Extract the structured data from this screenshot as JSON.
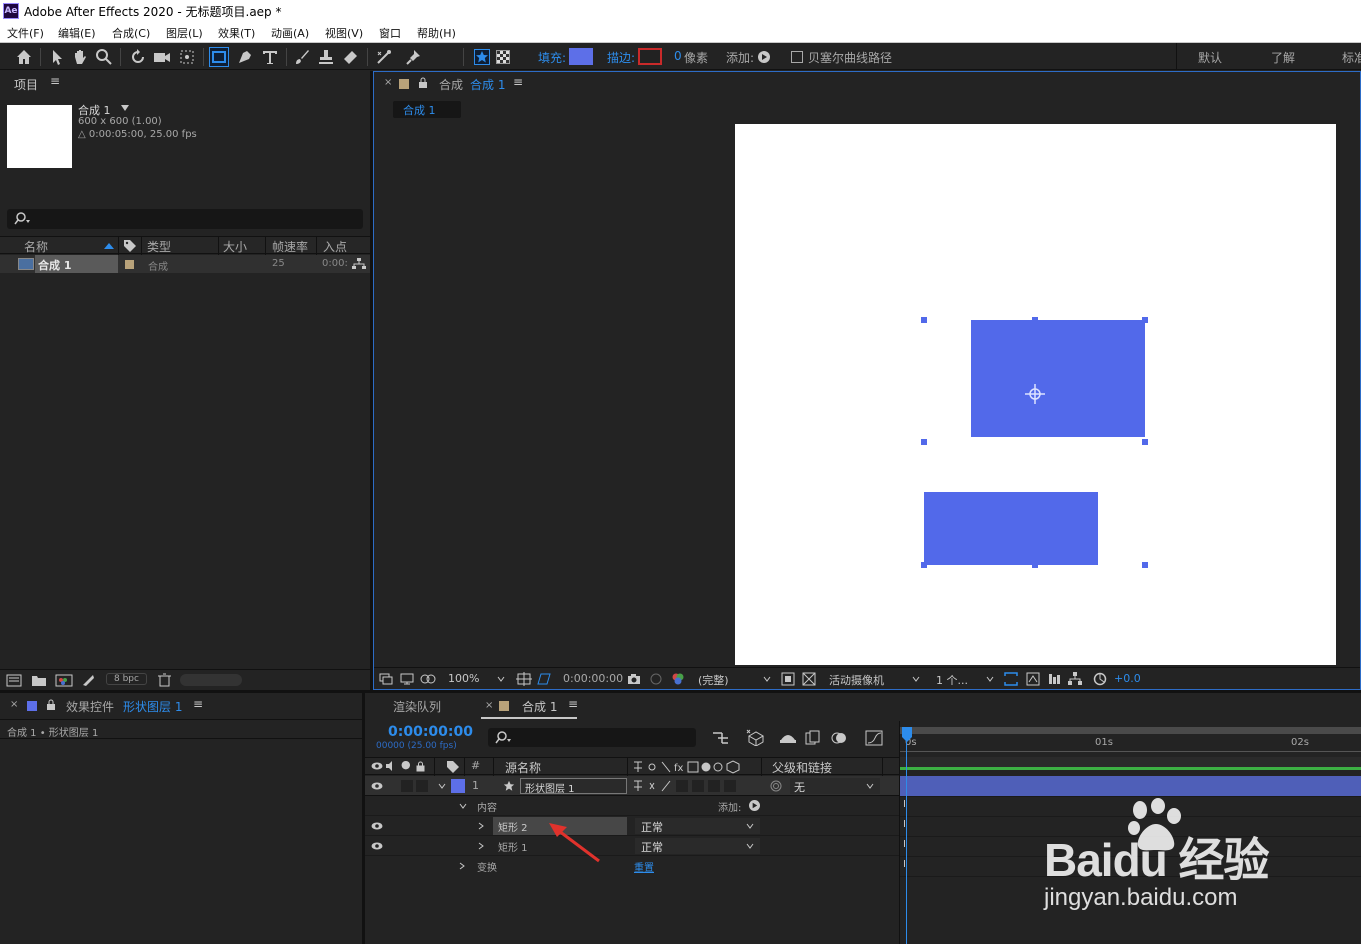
{
  "app": {
    "title": "Adobe After Effects 2020 - 无标题项目.aep *",
    "logo": "Ae"
  },
  "menu": [
    "文件(F)",
    "编辑(E)",
    "合成(C)",
    "图层(L)",
    "效果(T)",
    "动画(A)",
    "视图(V)",
    "窗口",
    "帮助(H)"
  ],
  "toolbar": {
    "fill_label": "填充:",
    "stroke_label": "描边:",
    "stroke_value": "0",
    "stroke_unit": "像素",
    "add_label": "添加:",
    "bezier_label": "贝塞尔曲线路径",
    "workspace_default": "默认",
    "workspace_learn": "了解",
    "workspace_std": "标准",
    "fill_color": "#5d6fe8",
    "stroke_color": "#c92a2a"
  },
  "project": {
    "panel_title": "项目",
    "comp_name": "合成 1",
    "comp_size": "600 x 600 (1.00)",
    "comp_duration": "△ 0:00:05:00, 25.00 fps",
    "columns": [
      "名称",
      "类型",
      "大小",
      "帧速率",
      "入点"
    ],
    "item": {
      "name": "合成 1",
      "type": "合成",
      "fps": "25",
      "in": "0:00:"
    },
    "bpc": "8 bpc"
  },
  "composition": {
    "tab_prefix": "合成",
    "tab_name": "合成 1",
    "subtab": "合成 1",
    "zoom": "100%",
    "timecode": "0:00:00:00",
    "resolution": "(完整)",
    "camera": "活动摄像机",
    "views": "1 个...",
    "exposure": "+0.0"
  },
  "effects": {
    "panel_prefix": "效果控件",
    "layer_name": "形状图层 1",
    "breadcrumb": "合成 1 • 形状图层 1"
  },
  "timeline": {
    "render_tab": "渲染队列",
    "comp_tab": "合成 1",
    "timecode": "0:00:00:00",
    "frame_info": "00000 (25.00 fps)",
    "col_number": "#",
    "col_source": "源名称",
    "col_parent": "父级和链接",
    "layer": {
      "index": "1",
      "name": "形状图层 1",
      "parent": "无"
    },
    "contents_label": "内容",
    "add_label": "添加:",
    "rect2": "矩形 2",
    "rect1": "矩形 1",
    "blend_mode": "正常",
    "transform_label": "变换",
    "reset_label": "重置",
    "ruler": [
      "0s",
      "01s",
      "02s"
    ]
  },
  "watermark": {
    "brand": "Baidu 经验",
    "url": "jingyan.baidu.com"
  }
}
